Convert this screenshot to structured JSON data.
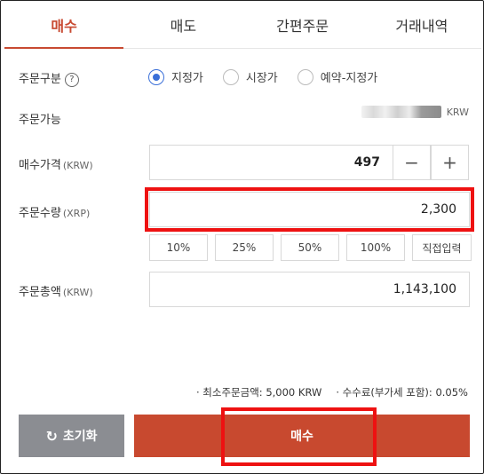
{
  "tabs": [
    {
      "label": "매수",
      "active": true
    },
    {
      "label": "매도",
      "active": false
    },
    {
      "label": "간편주문",
      "active": false
    },
    {
      "label": "거래내역",
      "active": false
    }
  ],
  "order_type": {
    "label": "주문구분",
    "help": "?",
    "options": [
      {
        "label": "지정가",
        "checked": true
      },
      {
        "label": "시장가",
        "checked": false
      },
      {
        "label": "예약-지정가",
        "checked": false
      }
    ]
  },
  "available": {
    "label": "주문가능",
    "unit": "KRW"
  },
  "price": {
    "label": "매수가격",
    "unit": "(KRW)",
    "value": "497",
    "minus": "−",
    "plus": "+"
  },
  "quantity": {
    "label": "주문수량",
    "unit": "(XRP)",
    "value": "2,300"
  },
  "percent_buttons": [
    "10%",
    "25%",
    "50%",
    "100%",
    "직접입력"
  ],
  "total": {
    "label": "주문총액",
    "unit": "(KRW)",
    "value": "1,143,100"
  },
  "notes": {
    "min_order": "· 최소주문금액: 5,000 KRW",
    "fee": "· 수수료(부가세 포함): 0.05%"
  },
  "buttons": {
    "reset": "초기화",
    "reset_icon": "↻",
    "buy": "매수"
  },
  "colors": {
    "accent": "#c8492f",
    "radio": "#3a6fd8",
    "highlight": "#ee1111",
    "reset_bg": "#8b8d92"
  }
}
